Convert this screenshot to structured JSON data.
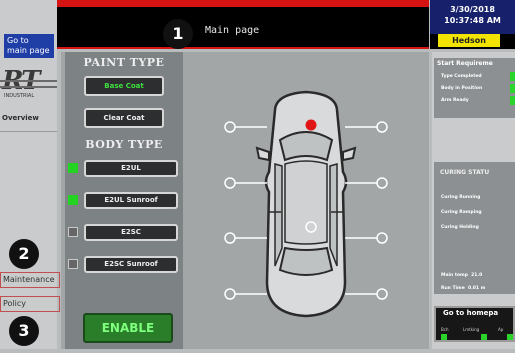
{
  "left_nav": {
    "goto_label": "Go to main page",
    "logo_text": "RT",
    "logo_subtext": "INDUSTRIAL",
    "overview_label": "Overview",
    "maintenance_label": "Maintenance",
    "policy_label": "Policy"
  },
  "callouts": {
    "one": "1",
    "two": "2",
    "three": "3"
  },
  "header": {
    "title": "Main page",
    "date": "3/30/2018",
    "time": "10:37:48 AM",
    "shift_name": "Hedson"
  },
  "paint": {
    "header": "PAINT TYPE",
    "options": [
      "Base Coat",
      "Clear Coat"
    ],
    "selected": "Base Coat"
  },
  "body": {
    "header": "BODY TYPE",
    "options": [
      "E2UL",
      "E2UL Sunroof",
      "E2SC",
      "E2SC Sunroof"
    ],
    "checked": [
      true,
      true,
      false,
      false
    ]
  },
  "enable_label": "ENABLE",
  "requirements": {
    "title": "Start Requireme",
    "rows": [
      "Type Completed",
      "Body in Position",
      "Arm Ready"
    ]
  },
  "curing": {
    "title": "CURING STATU",
    "rows": [
      "Curing Running",
      "Curing Ramping",
      "Curing Holding"
    ],
    "temp_label": "Main temp",
    "temp_value": "21.0",
    "time_label": "Run Time",
    "time_value": "0.01 m"
  },
  "go_home": {
    "label": "Go to homepa",
    "sub": [
      "Bch",
      "Lmtking",
      "Ap"
    ]
  },
  "colors": {
    "accent_red": "#d51313",
    "active_green": "#22d322",
    "nav_blue": "#1f3fa6",
    "shift_yellow": "#f2e400"
  },
  "car_points": {
    "active": "rear-left-roof",
    "total": 9
  }
}
